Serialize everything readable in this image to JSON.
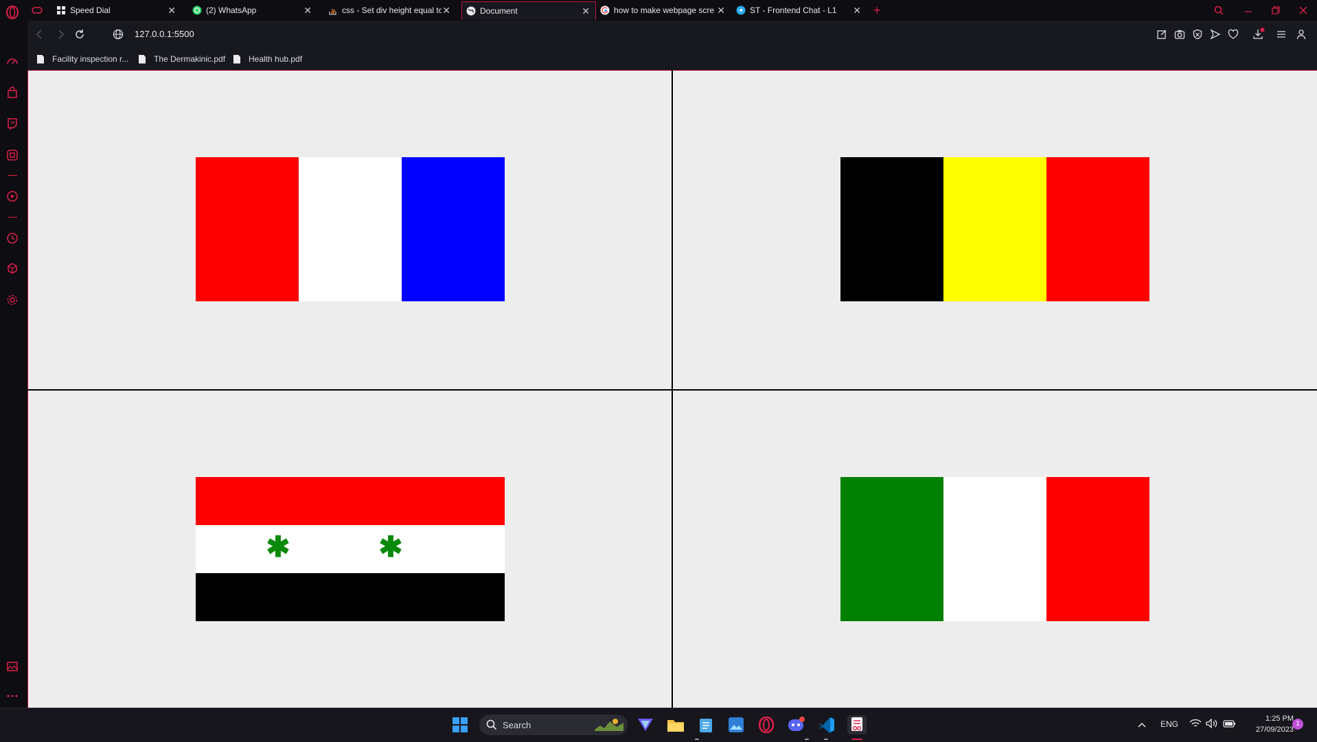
{
  "browser": {
    "tabs": [
      {
        "title": "Speed Dial",
        "icon": "speed-dial-icon"
      },
      {
        "title": "(2) WhatsApp",
        "icon": "whatsapp-icon"
      },
      {
        "title": "css - Set div height equal to",
        "icon": "stack-overflow-icon"
      },
      {
        "title": "Document",
        "icon": "globe-icon",
        "active": true
      },
      {
        "title": "how to make webpage scre",
        "icon": "google-icon"
      },
      {
        "title": "ST - Frontend Chat - L1",
        "icon": "telegram-icon"
      }
    ],
    "url": "127.0.0.1:5500",
    "bookmarks": [
      "Facility inspection r...",
      "The Dermakinic.pdf",
      "Health hub.pdf"
    ],
    "accent_color": "#e0204a"
  },
  "flags": [
    {
      "name": "france",
      "colors": [
        "#ff0000",
        "#ffffff",
        "#0000ff"
      ],
      "orientation": "vertical"
    },
    {
      "name": "belgium",
      "colors": [
        "#000000",
        "#ffff00",
        "#ff0000"
      ],
      "orientation": "vertical"
    },
    {
      "name": "syria",
      "colors": [
        "#ff0000",
        "#ffffff",
        "#000000"
      ],
      "orientation": "horizontal",
      "star_glyph": "✱",
      "star_color": "#0a8a0a"
    },
    {
      "name": "italy",
      "colors": [
        "#008000",
        "#ffffff",
        "#ff0000"
      ],
      "orientation": "vertical"
    }
  ],
  "taskbar": {
    "search_label": "Search",
    "language": "ENG",
    "time": "1:25 PM",
    "date": "27/09/2023",
    "notification_count": "1"
  }
}
